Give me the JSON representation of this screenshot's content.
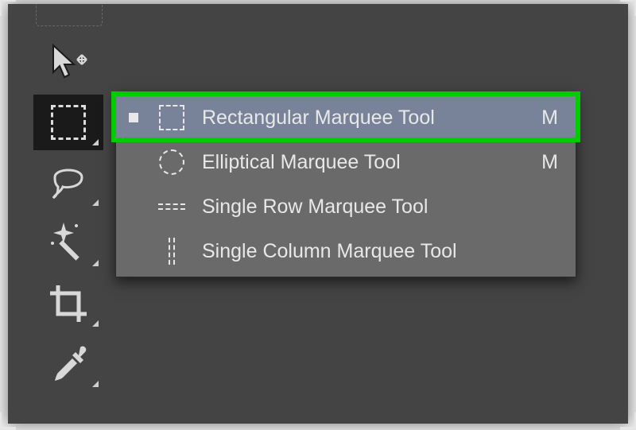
{
  "highlight_color": "#00cc00",
  "toolbar": {
    "tools": [
      {
        "name": "move-tool",
        "active": false
      },
      {
        "name": "marquee-tool",
        "active": true
      },
      {
        "name": "lasso-tool",
        "active": false
      },
      {
        "name": "magic-wand-tool",
        "active": false
      },
      {
        "name": "crop-tool",
        "active": false
      },
      {
        "name": "eyedropper-tool",
        "active": false
      }
    ]
  },
  "flyout": {
    "items": [
      {
        "label": "Rectangular Marquee Tool",
        "shortcut": "M",
        "icon": "rectangular-marquee-icon",
        "selected": true,
        "active_tool": true
      },
      {
        "label": "Elliptical Marquee Tool",
        "shortcut": "M",
        "icon": "elliptical-marquee-icon",
        "selected": false,
        "active_tool": false
      },
      {
        "label": "Single Row Marquee Tool",
        "shortcut": "",
        "icon": "single-row-marquee-icon",
        "selected": false,
        "active_tool": false
      },
      {
        "label": "Single Column Marquee Tool",
        "shortcut": "",
        "icon": "single-column-marquee-icon",
        "selected": false,
        "active_tool": false
      }
    ]
  }
}
